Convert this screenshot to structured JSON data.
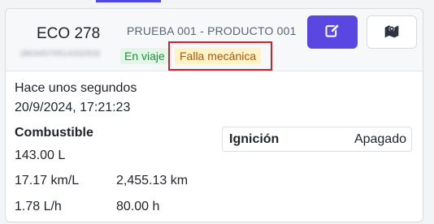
{
  "unit": {
    "name": "ECO 278",
    "id": "(863457051433263)",
    "route": "PRUEBA 001 - PRODUCTO 001"
  },
  "badges": {
    "status": "En viaje",
    "alert": "Falla mecánica"
  },
  "actions": {
    "edit_icon": "edit-icon",
    "map_icon": "map-pin-icon"
  },
  "update": {
    "relative": "Hace unos segundos",
    "timestamp": "20/9/2024, 17:21:23"
  },
  "fuel": {
    "title": "Combustible",
    "level": "143.00 L",
    "efficiency": "17.17 km/L",
    "distance": "2,455.13 km",
    "rate": "1.78 L/h",
    "hours": "80.00 h"
  },
  "ignition": {
    "label": "Ignición",
    "value": "Apagado"
  },
  "colors": {
    "primary": "#5a46e0",
    "status_green": "#1e8f3e",
    "alert_amber": "#b45309",
    "highlight_red": "#d0232a"
  }
}
